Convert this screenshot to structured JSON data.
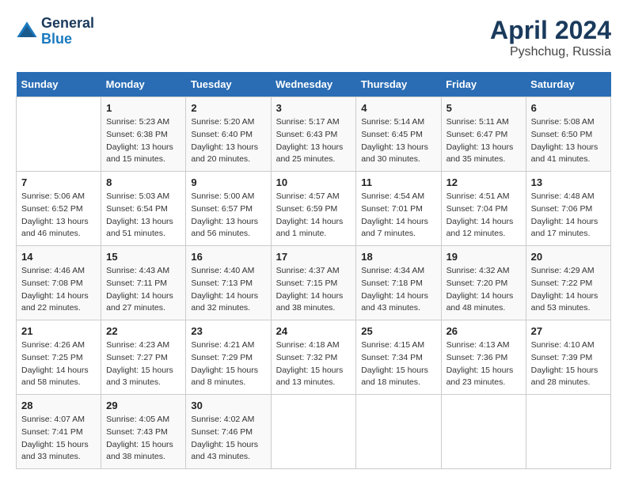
{
  "header": {
    "logo_line1": "General",
    "logo_line2": "Blue",
    "month": "April 2024",
    "location": "Pyshchug, Russia"
  },
  "days_of_week": [
    "Sunday",
    "Monday",
    "Tuesday",
    "Wednesday",
    "Thursday",
    "Friday",
    "Saturday"
  ],
  "weeks": [
    [
      {
        "day": "",
        "info": ""
      },
      {
        "day": "1",
        "info": "Sunrise: 5:23 AM\nSunset: 6:38 PM\nDaylight: 13 hours\nand 15 minutes."
      },
      {
        "day": "2",
        "info": "Sunrise: 5:20 AM\nSunset: 6:40 PM\nDaylight: 13 hours\nand 20 minutes."
      },
      {
        "day": "3",
        "info": "Sunrise: 5:17 AM\nSunset: 6:43 PM\nDaylight: 13 hours\nand 25 minutes."
      },
      {
        "day": "4",
        "info": "Sunrise: 5:14 AM\nSunset: 6:45 PM\nDaylight: 13 hours\nand 30 minutes."
      },
      {
        "day": "5",
        "info": "Sunrise: 5:11 AM\nSunset: 6:47 PM\nDaylight: 13 hours\nand 35 minutes."
      },
      {
        "day": "6",
        "info": "Sunrise: 5:08 AM\nSunset: 6:50 PM\nDaylight: 13 hours\nand 41 minutes."
      }
    ],
    [
      {
        "day": "7",
        "info": "Sunrise: 5:06 AM\nSunset: 6:52 PM\nDaylight: 13 hours\nand 46 minutes."
      },
      {
        "day": "8",
        "info": "Sunrise: 5:03 AM\nSunset: 6:54 PM\nDaylight: 13 hours\nand 51 minutes."
      },
      {
        "day": "9",
        "info": "Sunrise: 5:00 AM\nSunset: 6:57 PM\nDaylight: 13 hours\nand 56 minutes."
      },
      {
        "day": "10",
        "info": "Sunrise: 4:57 AM\nSunset: 6:59 PM\nDaylight: 14 hours\nand 1 minute."
      },
      {
        "day": "11",
        "info": "Sunrise: 4:54 AM\nSunset: 7:01 PM\nDaylight: 14 hours\nand 7 minutes."
      },
      {
        "day": "12",
        "info": "Sunrise: 4:51 AM\nSunset: 7:04 PM\nDaylight: 14 hours\nand 12 minutes."
      },
      {
        "day": "13",
        "info": "Sunrise: 4:48 AM\nSunset: 7:06 PM\nDaylight: 14 hours\nand 17 minutes."
      }
    ],
    [
      {
        "day": "14",
        "info": "Sunrise: 4:46 AM\nSunset: 7:08 PM\nDaylight: 14 hours\nand 22 minutes."
      },
      {
        "day": "15",
        "info": "Sunrise: 4:43 AM\nSunset: 7:11 PM\nDaylight: 14 hours\nand 27 minutes."
      },
      {
        "day": "16",
        "info": "Sunrise: 4:40 AM\nSunset: 7:13 PM\nDaylight: 14 hours\nand 32 minutes."
      },
      {
        "day": "17",
        "info": "Sunrise: 4:37 AM\nSunset: 7:15 PM\nDaylight: 14 hours\nand 38 minutes."
      },
      {
        "day": "18",
        "info": "Sunrise: 4:34 AM\nSunset: 7:18 PM\nDaylight: 14 hours\nand 43 minutes."
      },
      {
        "day": "19",
        "info": "Sunrise: 4:32 AM\nSunset: 7:20 PM\nDaylight: 14 hours\nand 48 minutes."
      },
      {
        "day": "20",
        "info": "Sunrise: 4:29 AM\nSunset: 7:22 PM\nDaylight: 14 hours\nand 53 minutes."
      }
    ],
    [
      {
        "day": "21",
        "info": "Sunrise: 4:26 AM\nSunset: 7:25 PM\nDaylight: 14 hours\nand 58 minutes."
      },
      {
        "day": "22",
        "info": "Sunrise: 4:23 AM\nSunset: 7:27 PM\nDaylight: 15 hours\nand 3 minutes."
      },
      {
        "day": "23",
        "info": "Sunrise: 4:21 AM\nSunset: 7:29 PM\nDaylight: 15 hours\nand 8 minutes."
      },
      {
        "day": "24",
        "info": "Sunrise: 4:18 AM\nSunset: 7:32 PM\nDaylight: 15 hours\nand 13 minutes."
      },
      {
        "day": "25",
        "info": "Sunrise: 4:15 AM\nSunset: 7:34 PM\nDaylight: 15 hours\nand 18 minutes."
      },
      {
        "day": "26",
        "info": "Sunrise: 4:13 AM\nSunset: 7:36 PM\nDaylight: 15 hours\nand 23 minutes."
      },
      {
        "day": "27",
        "info": "Sunrise: 4:10 AM\nSunset: 7:39 PM\nDaylight: 15 hours\nand 28 minutes."
      }
    ],
    [
      {
        "day": "28",
        "info": "Sunrise: 4:07 AM\nSunset: 7:41 PM\nDaylight: 15 hours\nand 33 minutes."
      },
      {
        "day": "29",
        "info": "Sunrise: 4:05 AM\nSunset: 7:43 PM\nDaylight: 15 hours\nand 38 minutes."
      },
      {
        "day": "30",
        "info": "Sunrise: 4:02 AM\nSunset: 7:46 PM\nDaylight: 15 hours\nand 43 minutes."
      },
      {
        "day": "",
        "info": ""
      },
      {
        "day": "",
        "info": ""
      },
      {
        "day": "",
        "info": ""
      },
      {
        "day": "",
        "info": ""
      }
    ]
  ]
}
